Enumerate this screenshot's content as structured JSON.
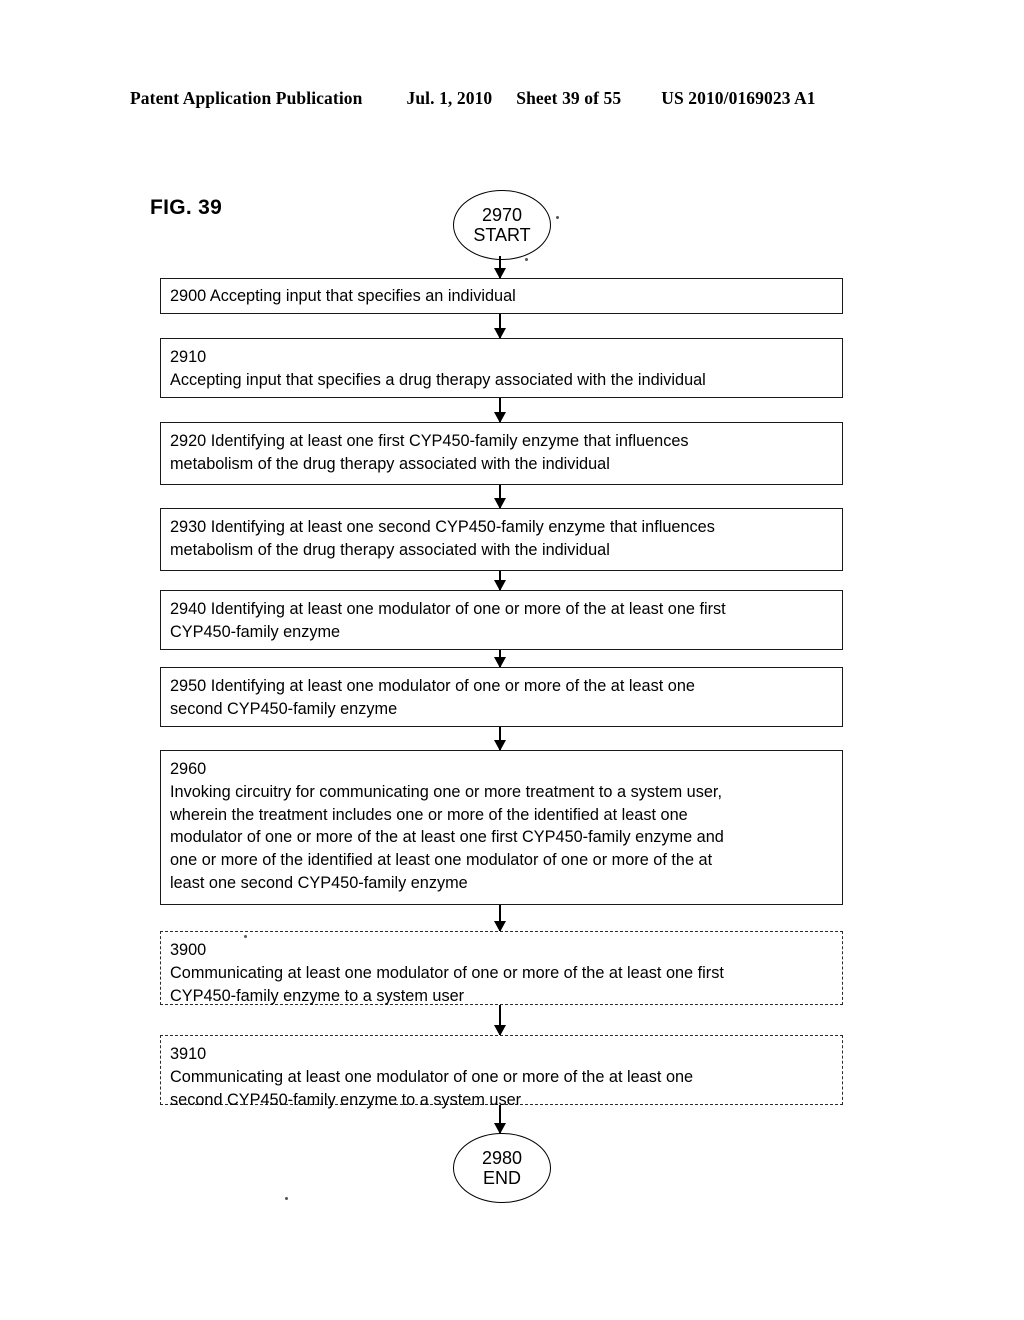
{
  "header": {
    "publication": "Patent Application Publication",
    "date": "Jul. 1, 2010",
    "sheet": "Sheet 39 of 55",
    "patent_number": "US 2010/0169023 A1"
  },
  "figure": {
    "label": "FIG. 39"
  },
  "flowchart": {
    "type": "flowchart",
    "start": {
      "id": "2970",
      "label": "START"
    },
    "end": {
      "id": "2980",
      "label": "END"
    },
    "steps": [
      {
        "id": "2900",
        "style": "solid",
        "number_inline": true,
        "lines": [
          "2900  Accepting input that specifies an individual"
        ]
      },
      {
        "id": "2910",
        "style": "solid",
        "number_inline": false,
        "lines": [
          "2910",
          "Accepting input that specifies a drug therapy associated with the individual"
        ]
      },
      {
        "id": "2920",
        "style": "solid",
        "number_inline": true,
        "lines": [
          "2920  Identifying at least one first CYP450-family enzyme that influences",
          "metabolism of the drug therapy associated with the individual"
        ]
      },
      {
        "id": "2930",
        "style": "solid",
        "number_inline": true,
        "lines": [
          "2930  Identifying at least one second CYP450-family enzyme that influences",
          "metabolism of the drug therapy associated with the individual"
        ]
      },
      {
        "id": "2940",
        "style": "solid",
        "number_inline": true,
        "lines": [
          "2940  Identifying at least one modulator of one or more of the at least one first",
          "CYP450-family enzyme"
        ]
      },
      {
        "id": "2950",
        "style": "solid",
        "number_inline": true,
        "lines": [
          "2950  Identifying at least one modulator of one or more of the at least one",
          "second CYP450-family enzyme"
        ]
      },
      {
        "id": "2960",
        "style": "solid",
        "number_inline": false,
        "lines": [
          "2960",
          "Invoking circuitry for communicating one or more treatment to a system user,",
          "wherein the treatment includes one or more of the identified at least one",
          "modulator of one or more of the at least one first CYP450-family enzyme and",
          "one or more of the identified at least one modulator of one or more of the at",
          "least one second CYP450-family enzyme"
        ]
      },
      {
        "id": "3900",
        "style": "dashed",
        "number_inline": false,
        "lines": [
          "3900",
          "Communicating at least one modulator of one or more of the at least one first",
          "CYP450-family enzyme to a system user"
        ]
      },
      {
        "id": "3910",
        "style": "dashed",
        "number_inline": false,
        "lines": [
          "3910",
          "Communicating at least one modulator of one or more of the at least one",
          "second CYP450-family enzyme to a system user"
        ]
      }
    ]
  }
}
